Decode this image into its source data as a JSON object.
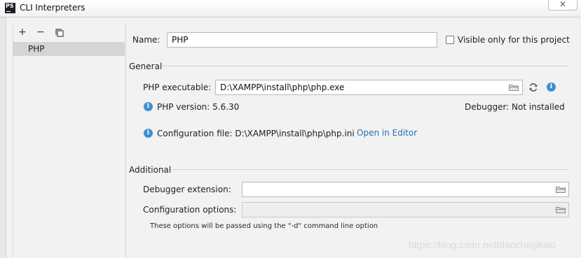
{
  "window": {
    "title": "CLI Interpreters",
    "app_badge": "PS",
    "close_glyph": "✕"
  },
  "toolbar": {
    "add": "+",
    "remove": "−"
  },
  "interpreters": [
    "PHP"
  ],
  "name": {
    "label": "Name:",
    "value": "PHP",
    "visible_only_label": "Visible only for this project"
  },
  "general": {
    "heading": "General",
    "executable_label": "PHP executable:",
    "executable_value": "D:\\XAMPP\\install\\php\\php.exe",
    "version_text": "PHP version: 5.6.30",
    "debugger_text": "Debugger: Not installed",
    "config_file_text": "Configuration file: D:\\XAMPP\\install\\php\\php.ini",
    "open_in_editor": "Open in Editor"
  },
  "additional": {
    "heading": "Additional",
    "debugger_extension_label": "Debugger extension:",
    "debugger_extension_value": "",
    "config_options_label": "Configuration options:",
    "config_options_value": "",
    "hint": "These options will be passed using the \"-d\" command line option"
  },
  "watermark": "https://blog.csdn.net/danchaijikaio",
  "icons": {
    "info": "info-icon",
    "folder": "folder-icon",
    "refresh": "refresh-icon",
    "copy": "copy-icon"
  },
  "colors": {
    "accent": "#3d8fd1",
    "link": "#2470b3",
    "selection": "#d5d5d5"
  }
}
